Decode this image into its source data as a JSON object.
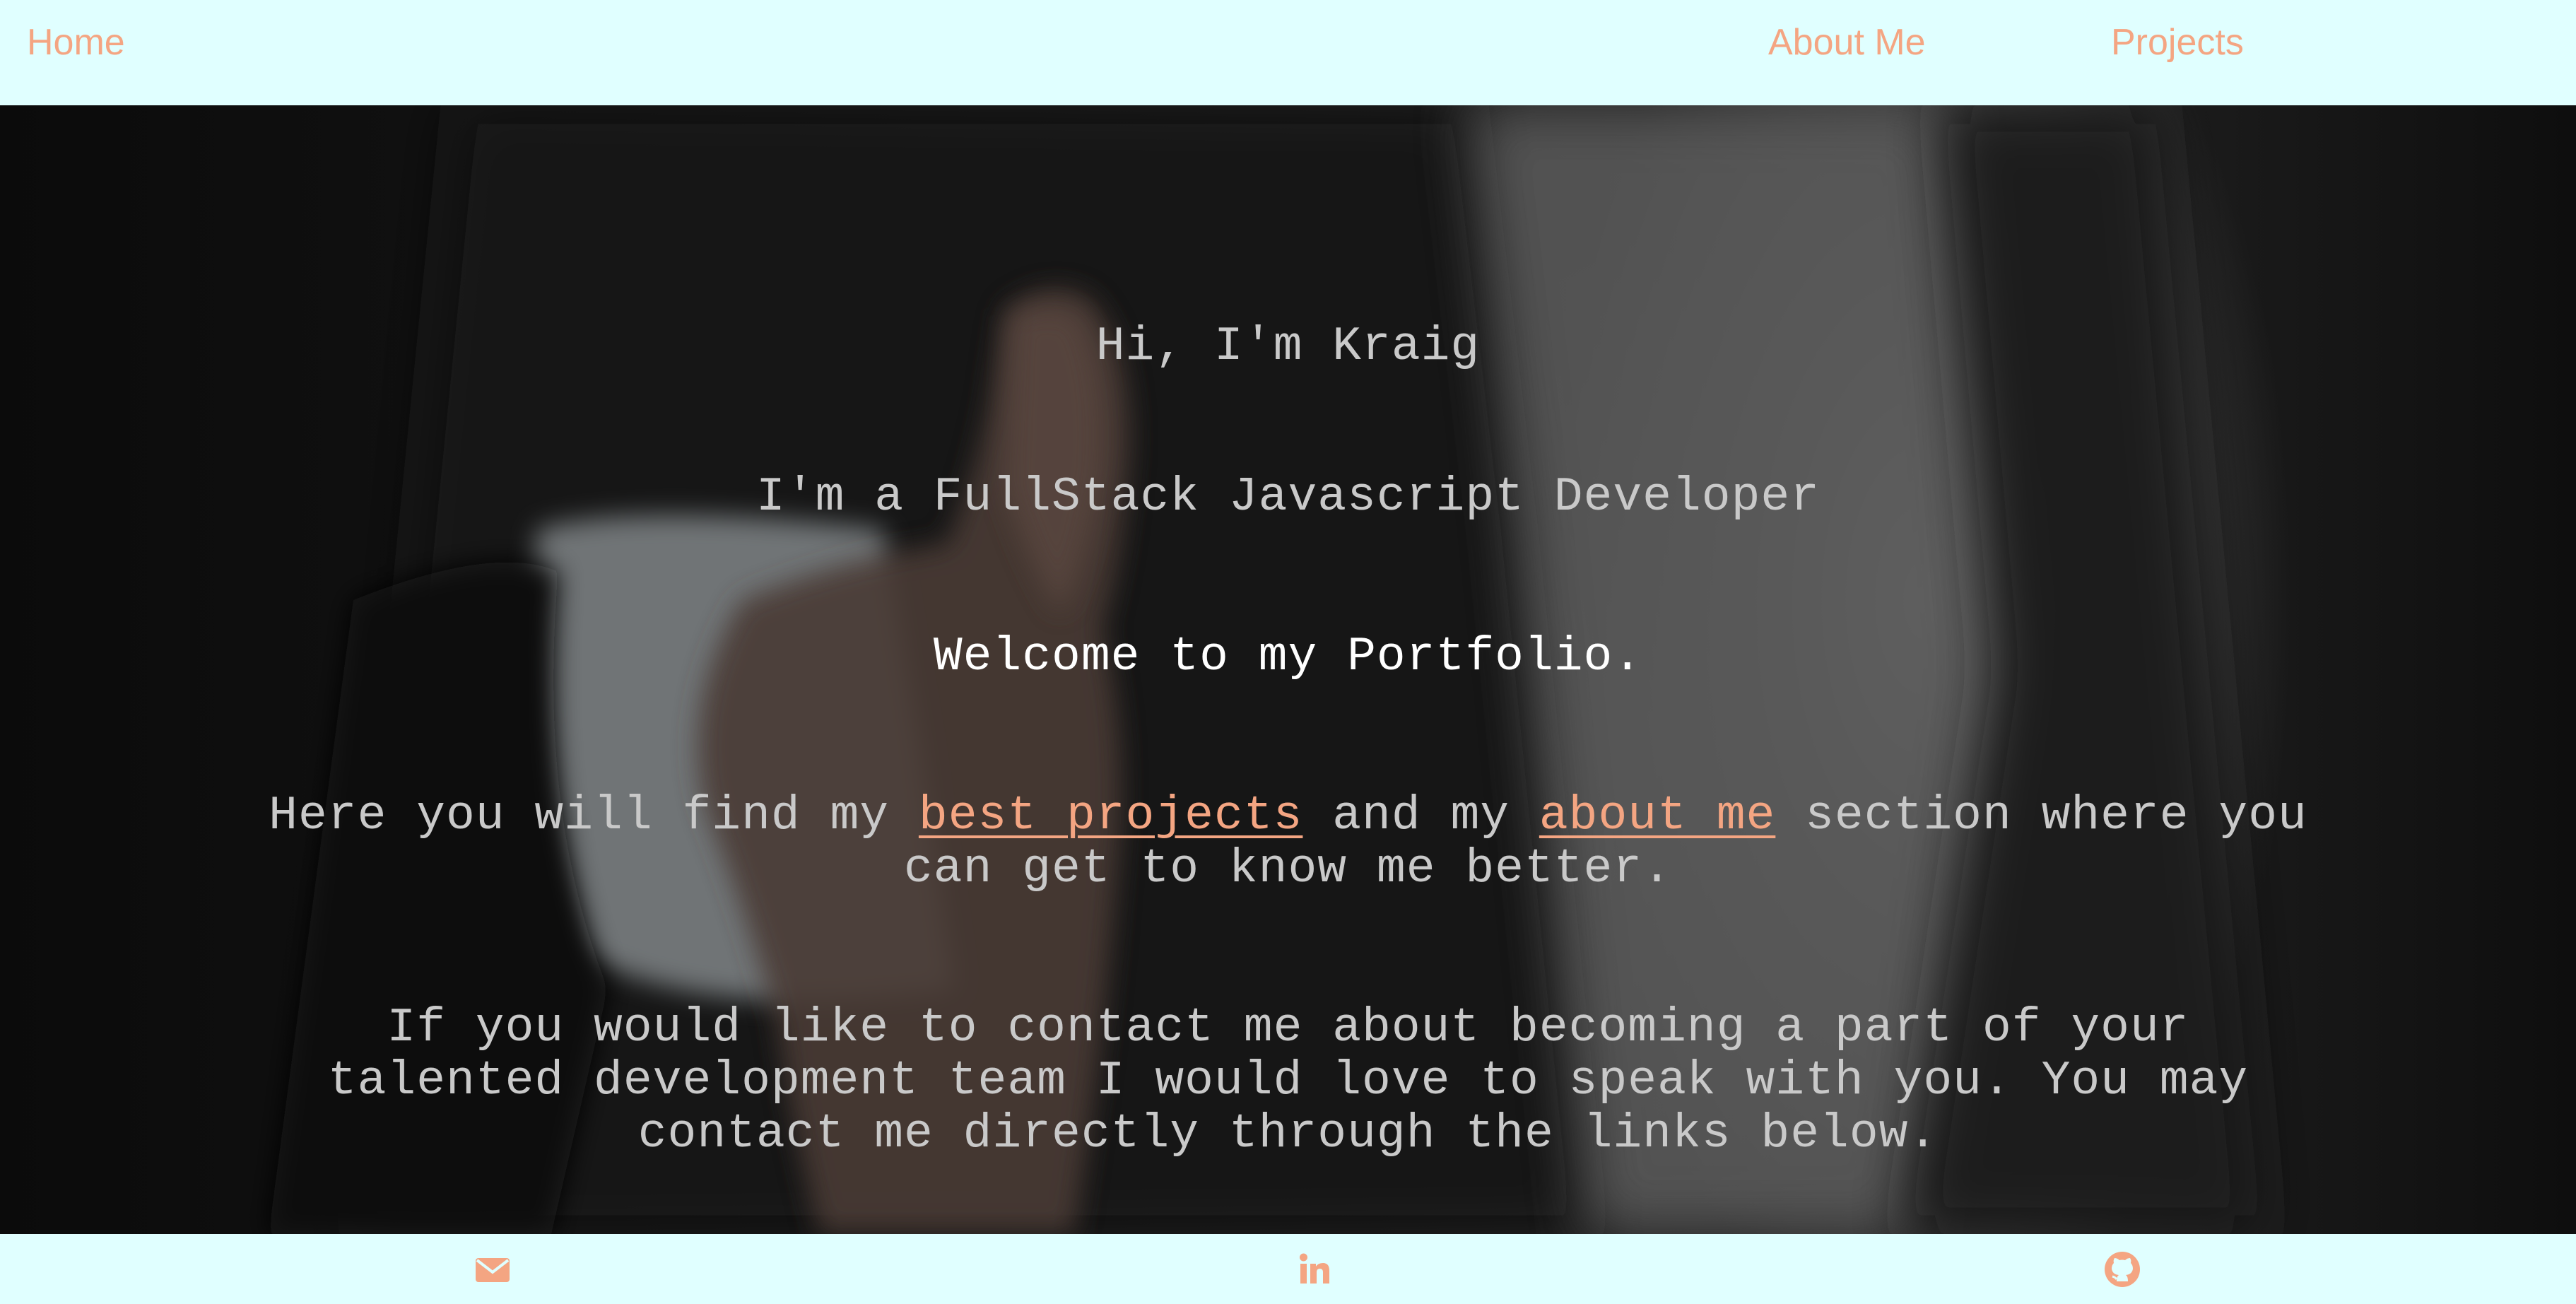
{
  "nav": {
    "home_label": "Home",
    "about_label": "About Me",
    "projects_label": "Projects"
  },
  "hero": {
    "greeting": "Hi, I'm Kraig",
    "role": "I'm a FullStack Javascript Developer",
    "welcome": "Welcome to my Portfolio.",
    "intro_prefix": "Here you will find my ",
    "intro_link_projects": "best projects",
    "intro_middle": " and my ",
    "intro_link_about": "about me",
    "intro_suffix": " section where you can get to know me better.",
    "contact": "If you would like to contact me about becoming a part of your talented development team I would love to speak with you. You may contact me directly through the links below."
  },
  "footer": {
    "icons": [
      "envelope-icon",
      "linkedin-icon",
      "github-icon"
    ]
  },
  "colors": {
    "nav_background": "#e0ffff",
    "accent": "#f4a582",
    "hero_text": "#c9c9c9"
  }
}
